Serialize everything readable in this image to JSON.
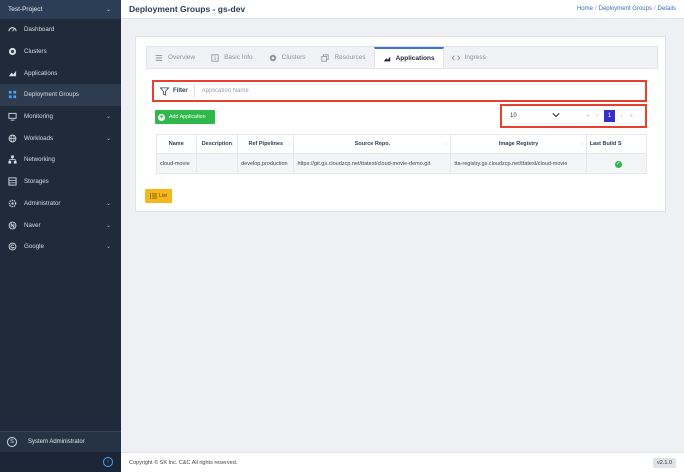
{
  "sidebar": {
    "project": "Test-Project",
    "items": [
      {
        "label": "Dashboard",
        "icon": "dashboard-icon",
        "expandable": false
      },
      {
        "label": "Clusters",
        "icon": "clusters-icon",
        "expandable": false
      },
      {
        "label": "Applications",
        "icon": "applications-icon",
        "expandable": false
      },
      {
        "label": "Deployment Groups",
        "icon": "deployment-groups-icon",
        "expandable": false,
        "active": true
      },
      {
        "label": "Monitoring",
        "icon": "monitor-icon",
        "expandable": true
      },
      {
        "label": "Workloads",
        "icon": "workloads-icon",
        "expandable": true
      },
      {
        "label": "Networking",
        "icon": "networking-icon",
        "expandable": true
      },
      {
        "label": "Storages",
        "icon": "storage-icon",
        "expandable": true
      },
      {
        "label": "Administrator",
        "icon": "admin-gear-icon",
        "expandable": true
      },
      {
        "label": "Naver",
        "icon": "naver-icon",
        "expandable": true
      },
      {
        "label": "Google",
        "icon": "google-icon",
        "expandable": true
      }
    ],
    "user": {
      "label": "System Administrator",
      "initial": "S"
    }
  },
  "header": {
    "title": "Deployment Groups - gs-dev",
    "breadcrumb": [
      "Home",
      "Deployment Groups",
      "Details"
    ]
  },
  "tabs": [
    {
      "label": "Overview",
      "icon": "overview-icon"
    },
    {
      "label": "Basic Info",
      "icon": "basic-info-icon"
    },
    {
      "label": "Clusters",
      "icon": "clusters-tab-icon"
    },
    {
      "label": "Resources",
      "icon": "resources-icon"
    },
    {
      "label": "Applications",
      "icon": "applications-tab-icon",
      "active": true
    },
    {
      "label": "Ingress",
      "icon": "ingress-icon"
    }
  ],
  "filter": {
    "label": "Filter",
    "placeholder": "Application Name",
    "value": ""
  },
  "add_button": {
    "label": "Add Application"
  },
  "pagination": {
    "page_size": "10",
    "current_page": "1",
    "first": "«",
    "prev": "‹",
    "next": "›",
    "last": "»"
  },
  "table": {
    "headers": [
      "Name",
      "Description",
      "Ref Pipelines",
      "Source Repo.",
      "Image Registry",
      "Last Build S"
    ],
    "rows": [
      {
        "name": "cloud-movie",
        "description": "",
        "ref_pipelines": "develop,production",
        "source_repo": "https://git.gs.cloudzcp.net/ttatest/cloud-movie-demo.git",
        "image_registry": "tta-registry.gs.cloudzcp.net/ttatest/cloud-movie",
        "last_build_status": "success"
      }
    ]
  },
  "list_button": {
    "label": "List"
  },
  "footer": {
    "copyright": "Copyright © SK Inc. C&C All rights reserved.",
    "version": "v2.1.0"
  },
  "colors": {
    "highlight": "#e8402c",
    "add_button": "#2fb94a",
    "list_button": "#f5b81a",
    "active_page": "#3730c8",
    "active_tab_border": "#3b72e0"
  }
}
